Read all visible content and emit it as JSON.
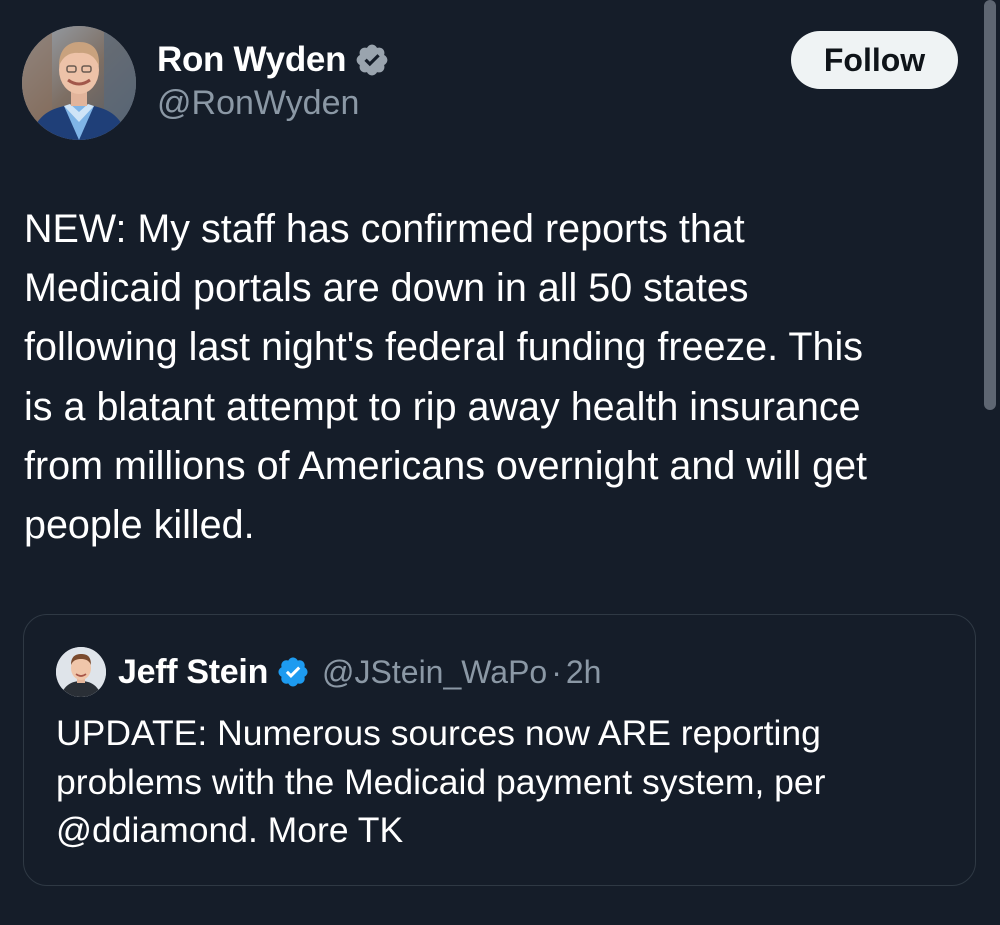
{
  "tweet": {
    "author": {
      "name": "Ron Wyden",
      "handle": "@RonWyden",
      "verified": true
    },
    "follow_label": "Follow",
    "text_lines": [
      "NEW: My staff has confirmed reports that",
      "Medicaid portals are down in all 50 states",
      "following last night's federal funding freeze. This",
      "is a blatant attempt to rip away health insurance",
      "from millions of Americans overnight and will get",
      "people killed."
    ]
  },
  "quoted": {
    "author": {
      "name": "Jeff Stein",
      "handle": "@JStein_WaPo",
      "verified": true
    },
    "separator": "·",
    "time": "2h",
    "text_lines": [
      "UPDATE: Numerous sources now ARE reporting",
      "problems with the Medicaid payment system, per",
      "@ddiamond. More TK"
    ]
  },
  "colors": {
    "background": "#151d29",
    "verified_blue": "#1d9bf0",
    "secondary_text": "#8b98a5",
    "follow_button_bg": "#eff3f4"
  },
  "icons": {
    "verified": "verified-badge-icon"
  }
}
